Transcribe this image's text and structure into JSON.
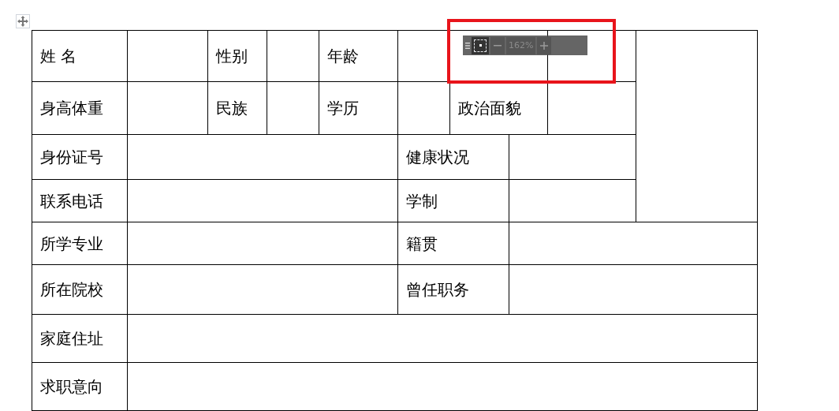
{
  "table": {
    "rows": [
      {
        "labels": [
          "姓 名",
          "性别",
          "年龄"
        ]
      },
      {
        "labels": [
          "身高体重",
          "民族",
          "学历",
          "政治面貌"
        ]
      },
      {
        "labels": [
          "身份证号",
          "健康状况"
        ]
      },
      {
        "labels": [
          "联系电话",
          "学制"
        ]
      },
      {
        "labels": [
          "所学专业",
          "籍贯"
        ]
      },
      {
        "labels": [
          "所在院校",
          "曾任职务"
        ]
      },
      {
        "labels": [
          "家庭住址"
        ]
      },
      {
        "labels": [
          "求职意向"
        ]
      }
    ]
  },
  "zoom_toolbar": {
    "zoom": "162%"
  }
}
